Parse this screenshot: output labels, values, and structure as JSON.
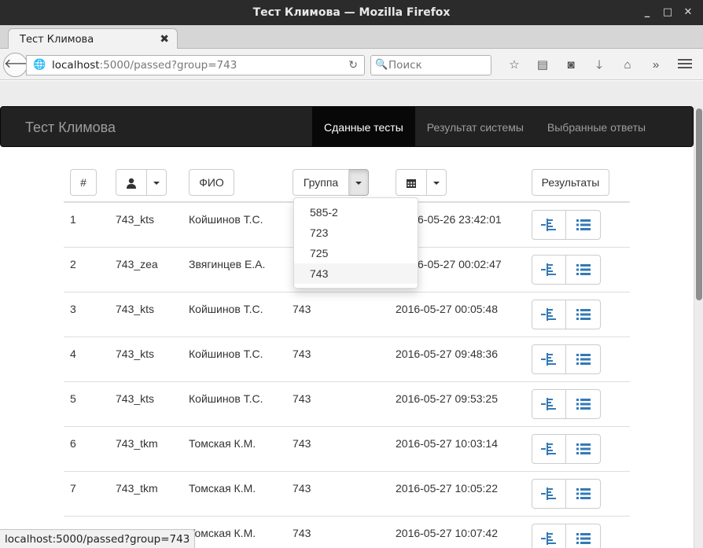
{
  "window": {
    "title": "Тест Климова — Mozilla Firefox",
    "controls": [
      "_",
      "□",
      "✕"
    ]
  },
  "tab": {
    "label": "Тест Климова",
    "close": "✖"
  },
  "navigation": {
    "url_host": "localhost",
    "url_rest": ":5000/passed?group=743",
    "search_placeholder": "Поиск"
  },
  "site": {
    "brand": "Тест Климова",
    "nav": [
      {
        "label": "Сданные тесты",
        "active": true
      },
      {
        "label": "Результат системы",
        "active": false
      },
      {
        "label": "Выбранные ответы",
        "active": false
      }
    ]
  },
  "table": {
    "headers": {
      "num": "#",
      "fio": "ФИО",
      "group": "Группа",
      "results": "Результаты"
    },
    "group_dropdown": {
      "options": [
        "585-2",
        "723",
        "725",
        "743"
      ],
      "highlighted": "743"
    },
    "rows": [
      {
        "n": "1",
        "login": "743_kts",
        "fio": "Койшинов Т.С.",
        "group": "",
        "date": "6-05-26 23:42:01"
      },
      {
        "n": "2",
        "login": "743_zea",
        "fio": "Звягинцев Е.А.",
        "group": "",
        "date": "6-05-27 00:02:47"
      },
      {
        "n": "3",
        "login": "743_kts",
        "fio": "Койшинов Т.С.",
        "group": "743",
        "date": "2016-05-27 00:05:48"
      },
      {
        "n": "4",
        "login": "743_kts",
        "fio": "Койшинов Т.С.",
        "group": "743",
        "date": "2016-05-27 09:48:36"
      },
      {
        "n": "5",
        "login": "743_kts",
        "fio": "Койшинов Т.С.",
        "group": "743",
        "date": "2016-05-27 09:53:25"
      },
      {
        "n": "6",
        "login": "743_tkm",
        "fio": "Томская К.М.",
        "group": "743",
        "date": "2016-05-27 10:03:14"
      },
      {
        "n": "7",
        "login": "743_tkm",
        "fio": "Томская К.М.",
        "group": "743",
        "date": "2016-05-27 10:05:22"
      },
      {
        "n": "",
        "login": "",
        "fio": "Томская К.М.",
        "group": "743",
        "date": "2016-05-27 10:07:42"
      }
    ]
  },
  "status": {
    "text": "localhost:5000/passed?group=743"
  },
  "colors": {
    "icon_blue": "#337ab7",
    "navbar": "#222222"
  }
}
